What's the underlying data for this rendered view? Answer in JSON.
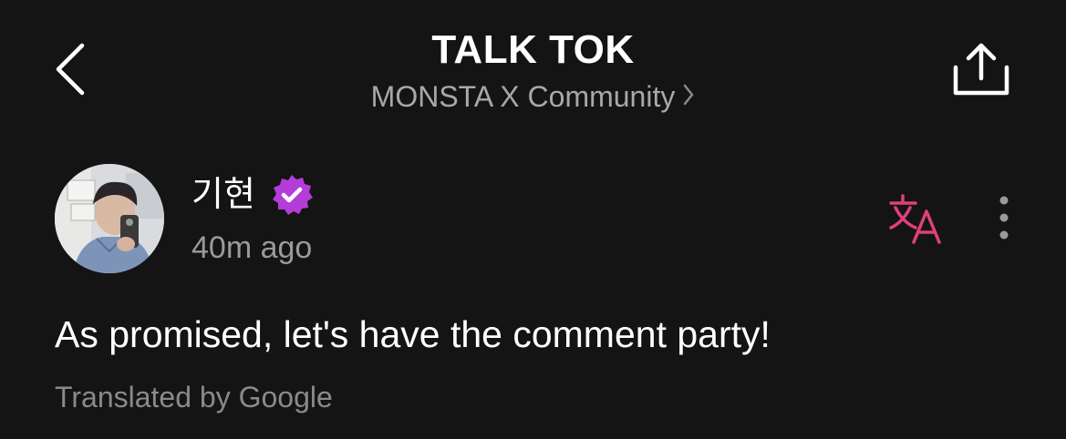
{
  "header": {
    "title": "TALK TOK",
    "community_label": "MONSTA X Community"
  },
  "post": {
    "author_name": "기현",
    "author_verified": true,
    "timestamp": "40m ago",
    "body": "As promised, let's have the comment party!",
    "translation_note": "Translated by Google"
  },
  "icons": {
    "back": "chevron-left-icon",
    "community_chevron": "chevron-right-icon",
    "share": "share-icon",
    "verified": "verified-badge-icon",
    "translate": "translate-icon",
    "more": "more-vertical-icon"
  },
  "colors": {
    "background": "#141414",
    "text_primary": "#ffffff",
    "text_secondary": "#a8a8a8",
    "accent_pink": "#e0407a",
    "badge_purple": "#b43cd8"
  }
}
